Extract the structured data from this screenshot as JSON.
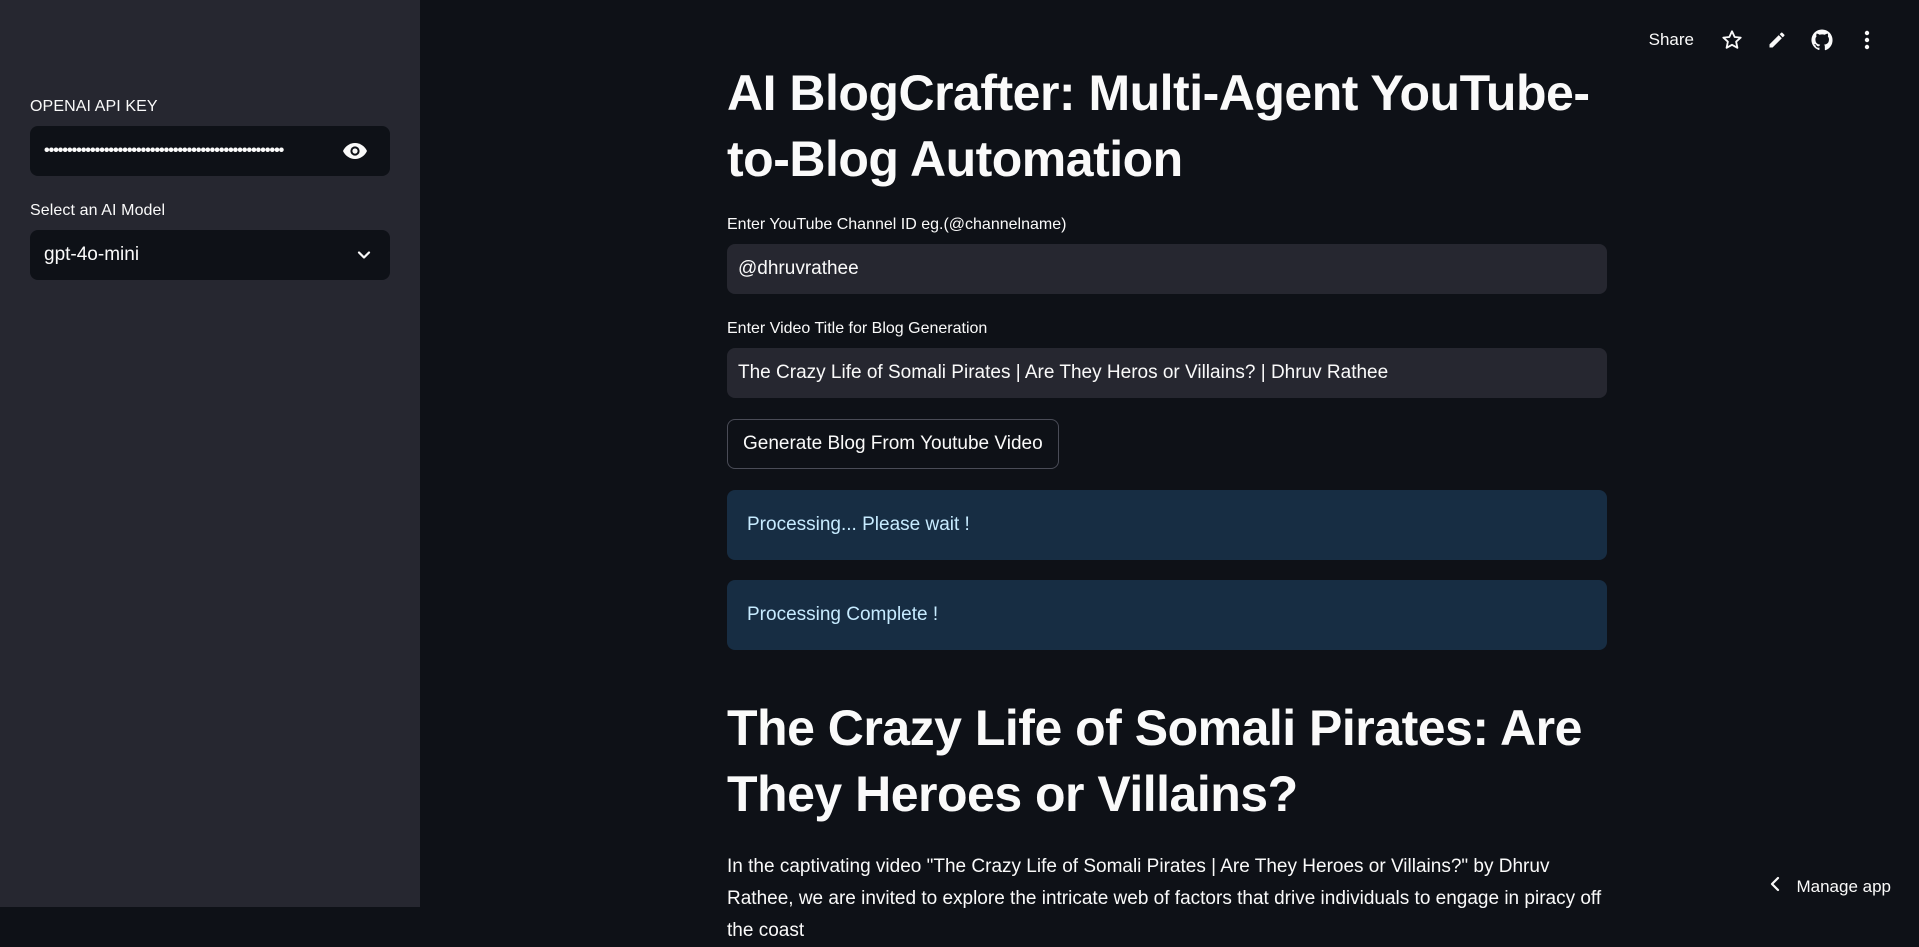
{
  "sidebar": {
    "api_key_label": "OPENAI API KEY",
    "api_key_value": "••••••••••••••••••••••••••••••••••••••••••••••••••••",
    "model_label": "Select an AI Model",
    "model_value": "gpt-4o-mini"
  },
  "topbar": {
    "share_label": "Share",
    "icons": [
      "star-icon",
      "edit-icon",
      "github-icon",
      "more-vertical-icon"
    ]
  },
  "main": {
    "title": "AI BlogCrafter: Multi-Agent YouTube-to-Blog Automation",
    "channel_label": "Enter YouTube Channel ID eg.(@channelname)",
    "channel_value": "@dhruvrathee",
    "video_label": "Enter Video Title for Blog Generation",
    "video_value": "The Crazy Life of Somali Pirates | Are They Heros or Villains? | Dhruv Rathee",
    "generate_button": "Generate Blog From Youtube Video",
    "status_processing": "Processing... Please wait !",
    "status_complete": "Processing Complete !",
    "blog_title": "The Crazy Life of Somali Pirates: Are They Heroes or Villains?",
    "blog_paragraph": "In the captivating video \"The Crazy Life of Somali Pirates | Are They Heroes or Villains?\" by Dhruv Rathee, we are invited to explore the intricate web of factors that drive individuals to engage in piracy off the coast"
  },
  "footer": {
    "manage_label": "Manage app"
  },
  "colors": {
    "background": "#0e1117",
    "sidebar": "#262730",
    "alert_bg": "#172d43",
    "alert_text": "#c7ebff"
  }
}
